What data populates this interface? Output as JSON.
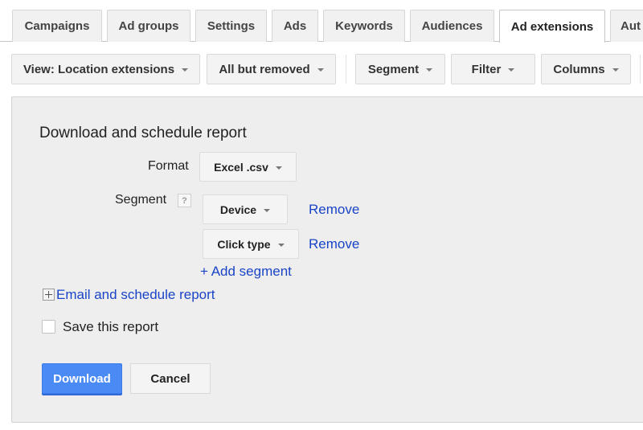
{
  "tabs": [
    {
      "label": "Campaigns",
      "active": false
    },
    {
      "label": "Ad groups",
      "active": false
    },
    {
      "label": "Settings",
      "active": false
    },
    {
      "label": "Ads",
      "active": false
    },
    {
      "label": "Keywords",
      "active": false
    },
    {
      "label": "Audiences",
      "active": false
    },
    {
      "label": "Ad extensions",
      "active": true
    },
    {
      "label": "Aut",
      "active": false
    }
  ],
  "toolbar": {
    "view_label": "View: Location extensions",
    "status_filter_label": "All but removed",
    "segment_label": "Segment",
    "filter_label": "Filter",
    "columns_label": "Columns"
  },
  "report_panel": {
    "title": "Download and schedule report",
    "format": {
      "label": "Format",
      "value": "Excel .csv"
    },
    "segment": {
      "label": "Segment",
      "help_icon": "?",
      "rows": [
        {
          "value": "Device",
          "remove_label": "Remove"
        },
        {
          "value": "Click type",
          "remove_label": "Remove"
        }
      ],
      "add_label": "+ Add segment"
    },
    "email_schedule_label": "Email and schedule report",
    "save_report": {
      "label": "Save this report",
      "checked": false
    },
    "download_label": "Download",
    "cancel_label": "Cancel"
  },
  "colors": {
    "link": "#1a44c7",
    "primary_button": "#4a8af4",
    "panel_background": "#eeeeee"
  }
}
